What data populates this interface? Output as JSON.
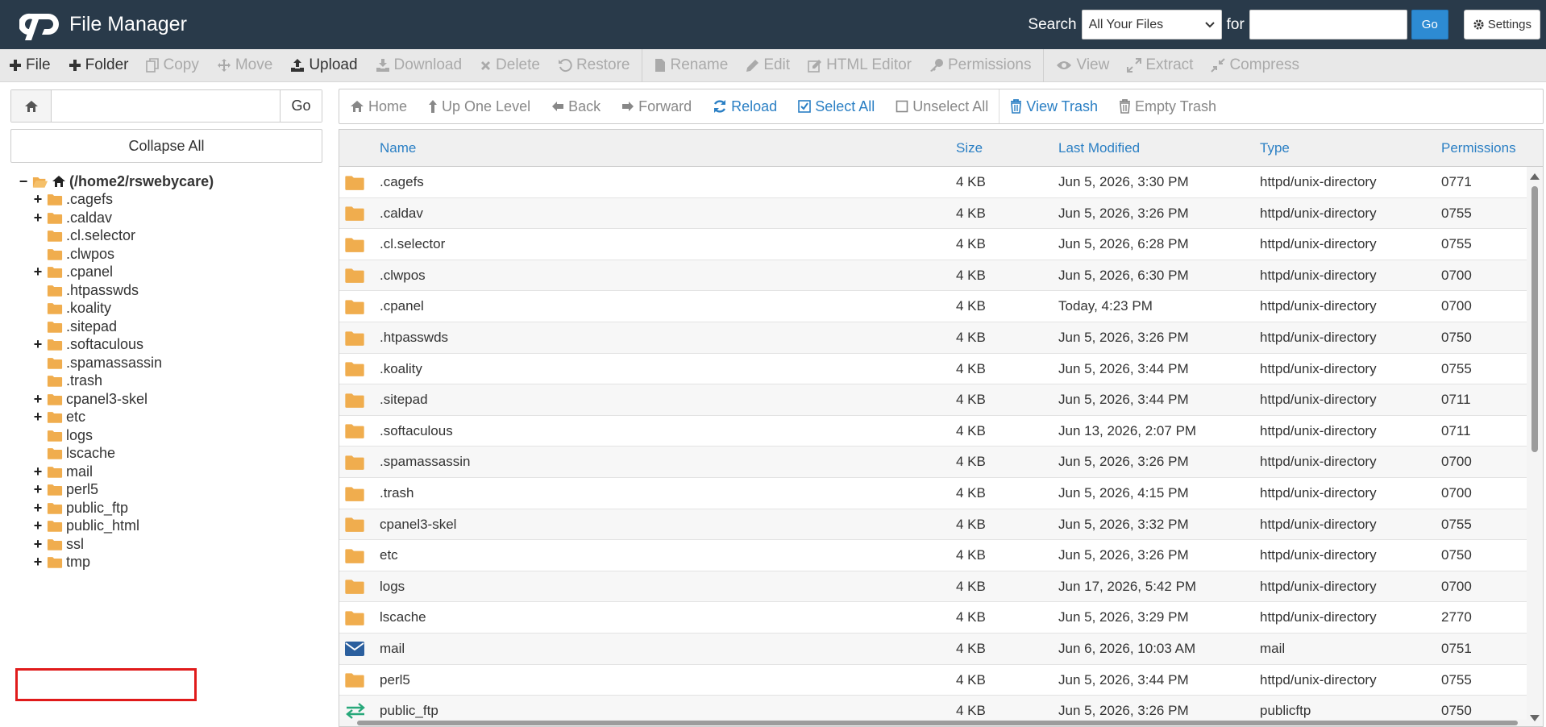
{
  "header": {
    "app_title": "File Manager",
    "search_label": "Search",
    "search_scope": "All Your Files",
    "for_label": "for",
    "search_value": "",
    "go_label": "Go",
    "settings_label": "Settings",
    "bg_color": "#293a4a",
    "accent_color": "#2d8bd3"
  },
  "toolbar": {
    "items": [
      {
        "label": "File",
        "icon": "plus-icon",
        "enabled": true
      },
      {
        "label": "Folder",
        "icon": "plus-icon",
        "enabled": true
      },
      {
        "label": "Copy",
        "icon": "copy-icon",
        "enabled": false
      },
      {
        "label": "Move",
        "icon": "move-icon",
        "enabled": false
      },
      {
        "label": "Upload",
        "icon": "upload-icon",
        "enabled": true
      },
      {
        "label": "Download",
        "icon": "download-icon",
        "enabled": false
      },
      {
        "label": "Delete",
        "icon": "delete-icon",
        "enabled": false
      },
      {
        "label": "Restore",
        "icon": "restore-icon",
        "enabled": false
      },
      {
        "label": "Rename",
        "icon": "rename-icon",
        "enabled": false
      },
      {
        "label": "Edit",
        "icon": "pencil-icon",
        "enabled": false
      },
      {
        "label": "HTML Editor",
        "icon": "html-editor-icon",
        "enabled": false
      },
      {
        "label": "Permissions",
        "icon": "key-icon",
        "enabled": false
      },
      {
        "label": "View",
        "icon": "eye-icon",
        "enabled": false
      },
      {
        "label": "Extract",
        "icon": "extract-icon",
        "enabled": false
      },
      {
        "label": "Compress",
        "icon": "compress-icon",
        "enabled": false
      }
    ]
  },
  "left": {
    "path_value": "",
    "path_go_label": "Go",
    "collapse_label": "Collapse All",
    "tree": [
      {
        "label": "(/home2/rswebycare)",
        "expander": "−",
        "root": true,
        "open": true
      },
      {
        "label": ".cagefs",
        "expander": "+"
      },
      {
        "label": ".caldav",
        "expander": "+"
      },
      {
        "label": ".cl.selector",
        "expander": ""
      },
      {
        "label": ".clwpos",
        "expander": ""
      },
      {
        "label": ".cpanel",
        "expander": "+"
      },
      {
        "label": ".htpasswds",
        "expander": ""
      },
      {
        "label": ".koality",
        "expander": ""
      },
      {
        "label": ".sitepad",
        "expander": ""
      },
      {
        "label": ".softaculous",
        "expander": "+"
      },
      {
        "label": ".spamassassin",
        "expander": ""
      },
      {
        "label": ".trash",
        "expander": ""
      },
      {
        "label": "cpanel3-skel",
        "expander": "+"
      },
      {
        "label": "etc",
        "expander": "+"
      },
      {
        "label": "logs",
        "expander": ""
      },
      {
        "label": "lscache",
        "expander": ""
      },
      {
        "label": "mail",
        "expander": "+"
      },
      {
        "label": "perl5",
        "expander": "+"
      },
      {
        "label": "public_ftp",
        "expander": "+"
      },
      {
        "label": "public_html",
        "expander": "+",
        "highlighted": true
      },
      {
        "label": "ssl",
        "expander": "+"
      },
      {
        "label": "tmp",
        "expander": "+"
      }
    ],
    "highlight_color": "#e01b1b"
  },
  "nav": {
    "items": [
      {
        "label": "Home",
        "icon": "home-icon",
        "blue": false
      },
      {
        "label": "Up One Level",
        "icon": "arrow-up-icon",
        "blue": false
      },
      {
        "label": "Back",
        "icon": "arrow-left-icon",
        "blue": false
      },
      {
        "label": "Forward",
        "icon": "arrow-right-icon",
        "blue": false
      },
      {
        "label": "Reload",
        "icon": "reload-icon",
        "blue": true
      },
      {
        "label": "Select All",
        "icon": "checkbox-checked-icon",
        "blue": true
      },
      {
        "label": "Unselect All",
        "icon": "checkbox-empty-icon",
        "blue": false
      },
      {
        "label": "View Trash",
        "icon": "trash-icon",
        "blue": true
      },
      {
        "label": "Empty Trash",
        "icon": "trash-icon",
        "blue": false
      }
    ]
  },
  "table": {
    "columns": [
      "Name",
      "Size",
      "Last Modified",
      "Type",
      "Permissions"
    ],
    "rows": [
      {
        "icon": "folder-icon",
        "name": ".cagefs",
        "size": "4 KB",
        "modified": "Jun 5, 2026, 3:30 PM",
        "type": "httpd/unix-directory",
        "perms": "0771"
      },
      {
        "icon": "folder-icon",
        "name": ".caldav",
        "size": "4 KB",
        "modified": "Jun 5, 2026, 3:26 PM",
        "type": "httpd/unix-directory",
        "perms": "0755"
      },
      {
        "icon": "folder-icon",
        "name": ".cl.selector",
        "size": "4 KB",
        "modified": "Jun 5, 2026, 6:28 PM",
        "type": "httpd/unix-directory",
        "perms": "0755"
      },
      {
        "icon": "folder-icon",
        "name": ".clwpos",
        "size": "4 KB",
        "modified": "Jun 5, 2026, 6:30 PM",
        "type": "httpd/unix-directory",
        "perms": "0700"
      },
      {
        "icon": "folder-icon",
        "name": ".cpanel",
        "size": "4 KB",
        "modified": "Today, 4:23 PM",
        "type": "httpd/unix-directory",
        "perms": "0700"
      },
      {
        "icon": "folder-icon",
        "name": ".htpasswds",
        "size": "4 KB",
        "modified": "Jun 5, 2026, 3:26 PM",
        "type": "httpd/unix-directory",
        "perms": "0750"
      },
      {
        "icon": "folder-icon",
        "name": ".koality",
        "size": "4 KB",
        "modified": "Jun 5, 2026, 3:44 PM",
        "type": "httpd/unix-directory",
        "perms": "0755"
      },
      {
        "icon": "folder-icon",
        "name": ".sitepad",
        "size": "4 KB",
        "modified": "Jun 5, 2026, 3:44 PM",
        "type": "httpd/unix-directory",
        "perms": "0711"
      },
      {
        "icon": "folder-icon",
        "name": ".softaculous",
        "size": "4 KB",
        "modified": "Jun 13, 2026, 2:07 PM",
        "type": "httpd/unix-directory",
        "perms": "0711"
      },
      {
        "icon": "folder-icon",
        "name": ".spamassassin",
        "size": "4 KB",
        "modified": "Jun 5, 2026, 3:26 PM",
        "type": "httpd/unix-directory",
        "perms": "0700"
      },
      {
        "icon": "folder-icon",
        "name": ".trash",
        "size": "4 KB",
        "modified": "Jun 5, 2026, 4:15 PM",
        "type": "httpd/unix-directory",
        "perms": "0700"
      },
      {
        "icon": "folder-icon",
        "name": "cpanel3-skel",
        "size": "4 KB",
        "modified": "Jun 5, 2026, 3:32 PM",
        "type": "httpd/unix-directory",
        "perms": "0755"
      },
      {
        "icon": "folder-icon",
        "name": "etc",
        "size": "4 KB",
        "modified": "Jun 5, 2026, 3:26 PM",
        "type": "httpd/unix-directory",
        "perms": "0750"
      },
      {
        "icon": "folder-icon",
        "name": "logs",
        "size": "4 KB",
        "modified": "Jun 17, 2026, 5:42 PM",
        "type": "httpd/unix-directory",
        "perms": "0700"
      },
      {
        "icon": "folder-icon",
        "name": "lscache",
        "size": "4 KB",
        "modified": "Jun 5, 2026, 3:29 PM",
        "type": "httpd/unix-directory",
        "perms": "2770"
      },
      {
        "icon": "mail-icon",
        "name": "mail",
        "size": "4 KB",
        "modified": "Jun 6, 2026, 10:03 AM",
        "type": "mail",
        "perms": "0751"
      },
      {
        "icon": "folder-icon",
        "name": "perl5",
        "size": "4 KB",
        "modified": "Jun 5, 2026, 3:44 PM",
        "type": "httpd/unix-directory",
        "perms": "0755"
      },
      {
        "icon": "ftp-icon",
        "name": "public_ftp",
        "size": "4 KB",
        "modified": "Jun 5, 2026, 3:26 PM",
        "type": "publicftp",
        "perms": "0750"
      }
    ]
  },
  "colors": {
    "folder": "#f0ad4e",
    "link_blue": "#2a7fc4",
    "mail_blue": "#2b5f9e",
    "ftp_green": "#27a87a"
  }
}
